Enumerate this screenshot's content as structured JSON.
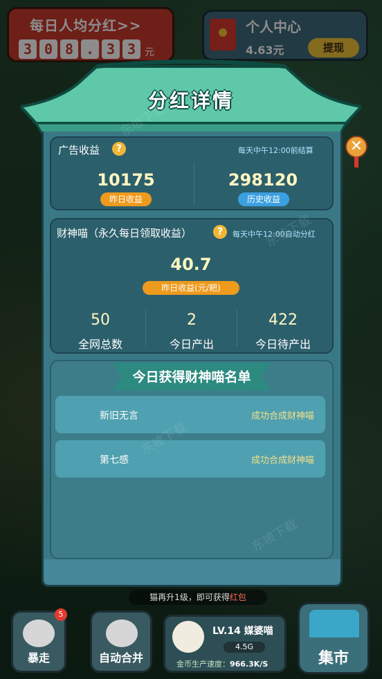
{
  "background": {
    "dividend_panel": {
      "title": "每日人均分红>>",
      "digits": [
        "3",
        "0",
        "8",
        ".",
        "3",
        "3"
      ],
      "unit": "元"
    },
    "personal_center": {
      "title": "个人中心",
      "amount": "4.63元",
      "withdraw_label": "提现"
    }
  },
  "modal": {
    "title": "分红详情",
    "close_icon": "close-icon",
    "ad_income": {
      "label": "广告收益",
      "note": "每天中午12:00前结算",
      "yesterday_value": "10175",
      "yesterday_label": "昨日收益",
      "history_value": "298120",
      "history_label": "历史收益"
    },
    "fortune_cat": {
      "label": "财神喵（永久每日领取收益）",
      "note": "每天中午12:00自动分红",
      "yesterday_value": "40.7",
      "yesterday_label": "昨日收益(元/耙)",
      "stats": [
        {
          "value": "50",
          "label": "全网总数"
        },
        {
          "value": "2",
          "label": "今日产出"
        },
        {
          "value": "422",
          "label": "今日待产出"
        }
      ]
    },
    "today_list": {
      "title": "今日获得财神喵名单",
      "rows": [
        {
          "name": "新旧无言",
          "status": "成功合成财神喵"
        },
        {
          "name": "第七感",
          "status": "成功合成财神喵"
        }
      ]
    }
  },
  "hud": {
    "hint_prefix": "猫再升",
    "hint_number": "1",
    "hint_middle": "级，即可获得",
    "hint_red": "红包",
    "buttons": [
      {
        "label": "暴走",
        "badge": "5"
      },
      {
        "label": "自动合并"
      }
    ],
    "level": {
      "text": "LV.14 媒婆喵",
      "coins": "4.5G",
      "speed_label": "金币生产速度：",
      "speed_value": "966.3K/S"
    },
    "market_label": "集市"
  },
  "watermark_text": "东坡下载",
  "colors": {
    "accent_yellow": "#fff7c2",
    "pill_orange": "#ee9a1d",
    "pill_blue": "#3ba0e0",
    "modal_teal": "#3a7886",
    "roof_green": "#5ec8a8"
  }
}
